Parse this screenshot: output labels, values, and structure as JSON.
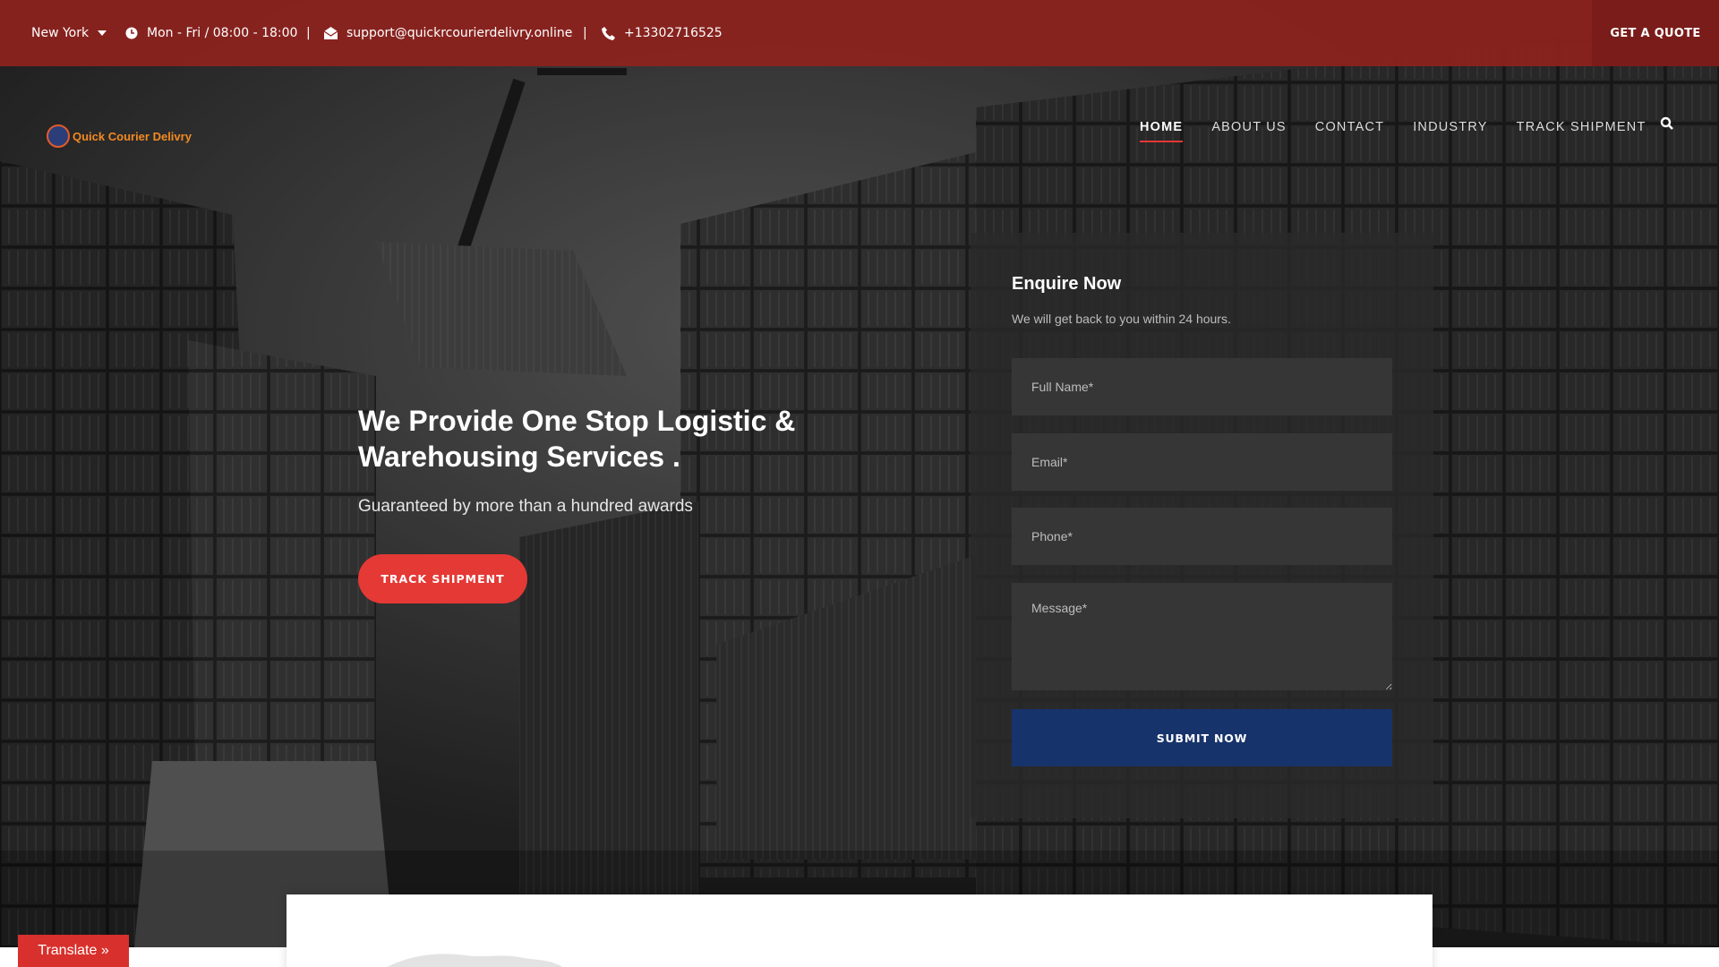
{
  "topbar": {
    "city": "New York",
    "hours": "Mon - Fri / 08:00 - 18:00",
    "separator": "|",
    "email": "support@quickrcourierdelivry.online",
    "phone": "+13302716525",
    "quote_label": "GET A QUOTE"
  },
  "header": {
    "logo_text": "Quick Courier Delivry",
    "nav": [
      {
        "label": "HOME",
        "active": true
      },
      {
        "label": "ABOUT US",
        "active": false
      },
      {
        "label": "CONTACT",
        "active": false
      },
      {
        "label": "INDUSTRY",
        "active": false
      },
      {
        "label": "TRACK SHIPMENT",
        "active": false
      }
    ]
  },
  "hero": {
    "title": "We Provide One Stop Logistic & Warehousing Services .",
    "subtitle": "Guaranteed by more than a hundred awards",
    "button_label": "TRACK SHIPMENT"
  },
  "enquiry": {
    "title": "Enquire Now",
    "subtitle": "We will get back to you within 24 hours.",
    "name_placeholder": "Full Name*",
    "email_placeholder": "Email*",
    "phone_placeholder": "Phone*",
    "message_placeholder": "Message*",
    "submit_label": "SUBMIT NOW"
  },
  "translate_label": "Translate »",
  "colors": {
    "topbar": "#8e221e",
    "accent_red": "#e53935",
    "submit_blue": "#17336b",
    "logo_orange": "#f28a21"
  },
  "icons": [
    "chevron-down-icon",
    "clock-icon",
    "envelope-icon",
    "phone-icon",
    "search-icon"
  ]
}
